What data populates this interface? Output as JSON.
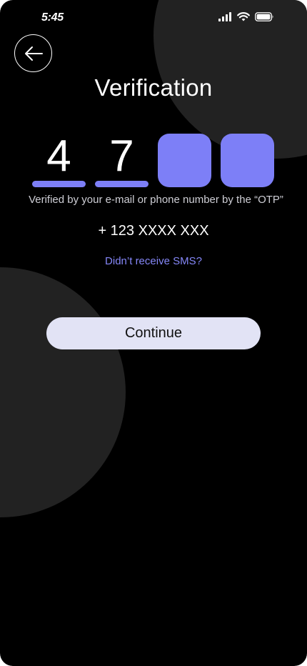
{
  "status_bar": {
    "time": "5:45",
    "icons": [
      "cellular-signal-icon",
      "wifi-icon",
      "battery-icon"
    ]
  },
  "header": {
    "back_icon": "arrow-left-icon",
    "title": "Verification"
  },
  "otp": {
    "digits": [
      "4",
      "7",
      "",
      ""
    ]
  },
  "helper": {
    "text": "Verified by your e-mail or phone number by the “OTP”",
    "phone": "+ 123 XXXX XXX"
  },
  "resend": {
    "label": "Didn’t receive SMS?"
  },
  "actions": {
    "continue_label": "Continue"
  },
  "colors": {
    "background": "#000000",
    "decor_circle": "#222222",
    "accent": "#7d7ff7",
    "link": "#8587f8",
    "button_bg": "#e2e3f5",
    "text": "#ffffff"
  }
}
